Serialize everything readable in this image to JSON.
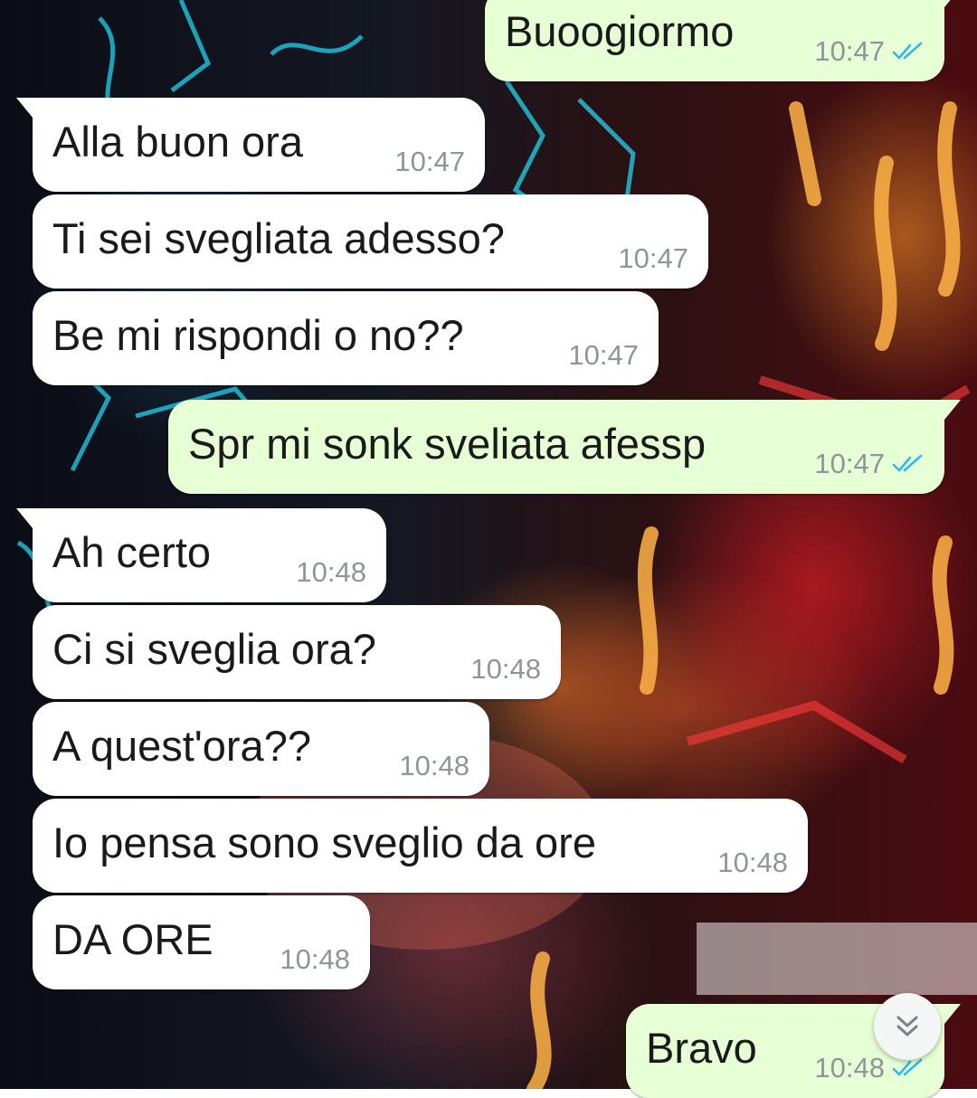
{
  "messages": [
    {
      "id": "m1",
      "direction": "out",
      "text": "Buoogiormo",
      "time": "10:47",
      "status": "read"
    },
    {
      "id": "m2",
      "direction": "in",
      "text": "Alla buon ora",
      "time": "10:47"
    },
    {
      "id": "m3",
      "direction": "in",
      "text": "Ti sei svegliata adesso?",
      "time": "10:47"
    },
    {
      "id": "m4",
      "direction": "in",
      "text": "Be mi rispondi o no??",
      "time": "10:47"
    },
    {
      "id": "m5",
      "direction": "out",
      "text": "Spr mi sonk sveliata afessp",
      "time": "10:47",
      "status": "read"
    },
    {
      "id": "m6",
      "direction": "in",
      "text": "Ah certo",
      "time": "10:48"
    },
    {
      "id": "m7",
      "direction": "in",
      "text": "Ci si sveglia ora?",
      "time": "10:48"
    },
    {
      "id": "m8",
      "direction": "in",
      "text": "A quest'ora??",
      "time": "10:48"
    },
    {
      "id": "m9",
      "direction": "in",
      "text": "Io pensa sono sveglio da ore",
      "time": "10:48"
    },
    {
      "id": "m10",
      "direction": "in",
      "text": "DA ORE",
      "time": "10:48"
    },
    {
      "id": "m11",
      "direction": "out",
      "text": "Bravo",
      "time": "10:48",
      "status": "read"
    }
  ],
  "colors": {
    "incoming_bubble": "#ffffff",
    "outgoing_bubble": "#e6ffd5",
    "timestamp": "#8f959a",
    "read_ticks": "#34b7f1"
  },
  "icons": {
    "read_receipt": "double-check-icon",
    "scroll_down": "chevron-down-double-icon"
  }
}
